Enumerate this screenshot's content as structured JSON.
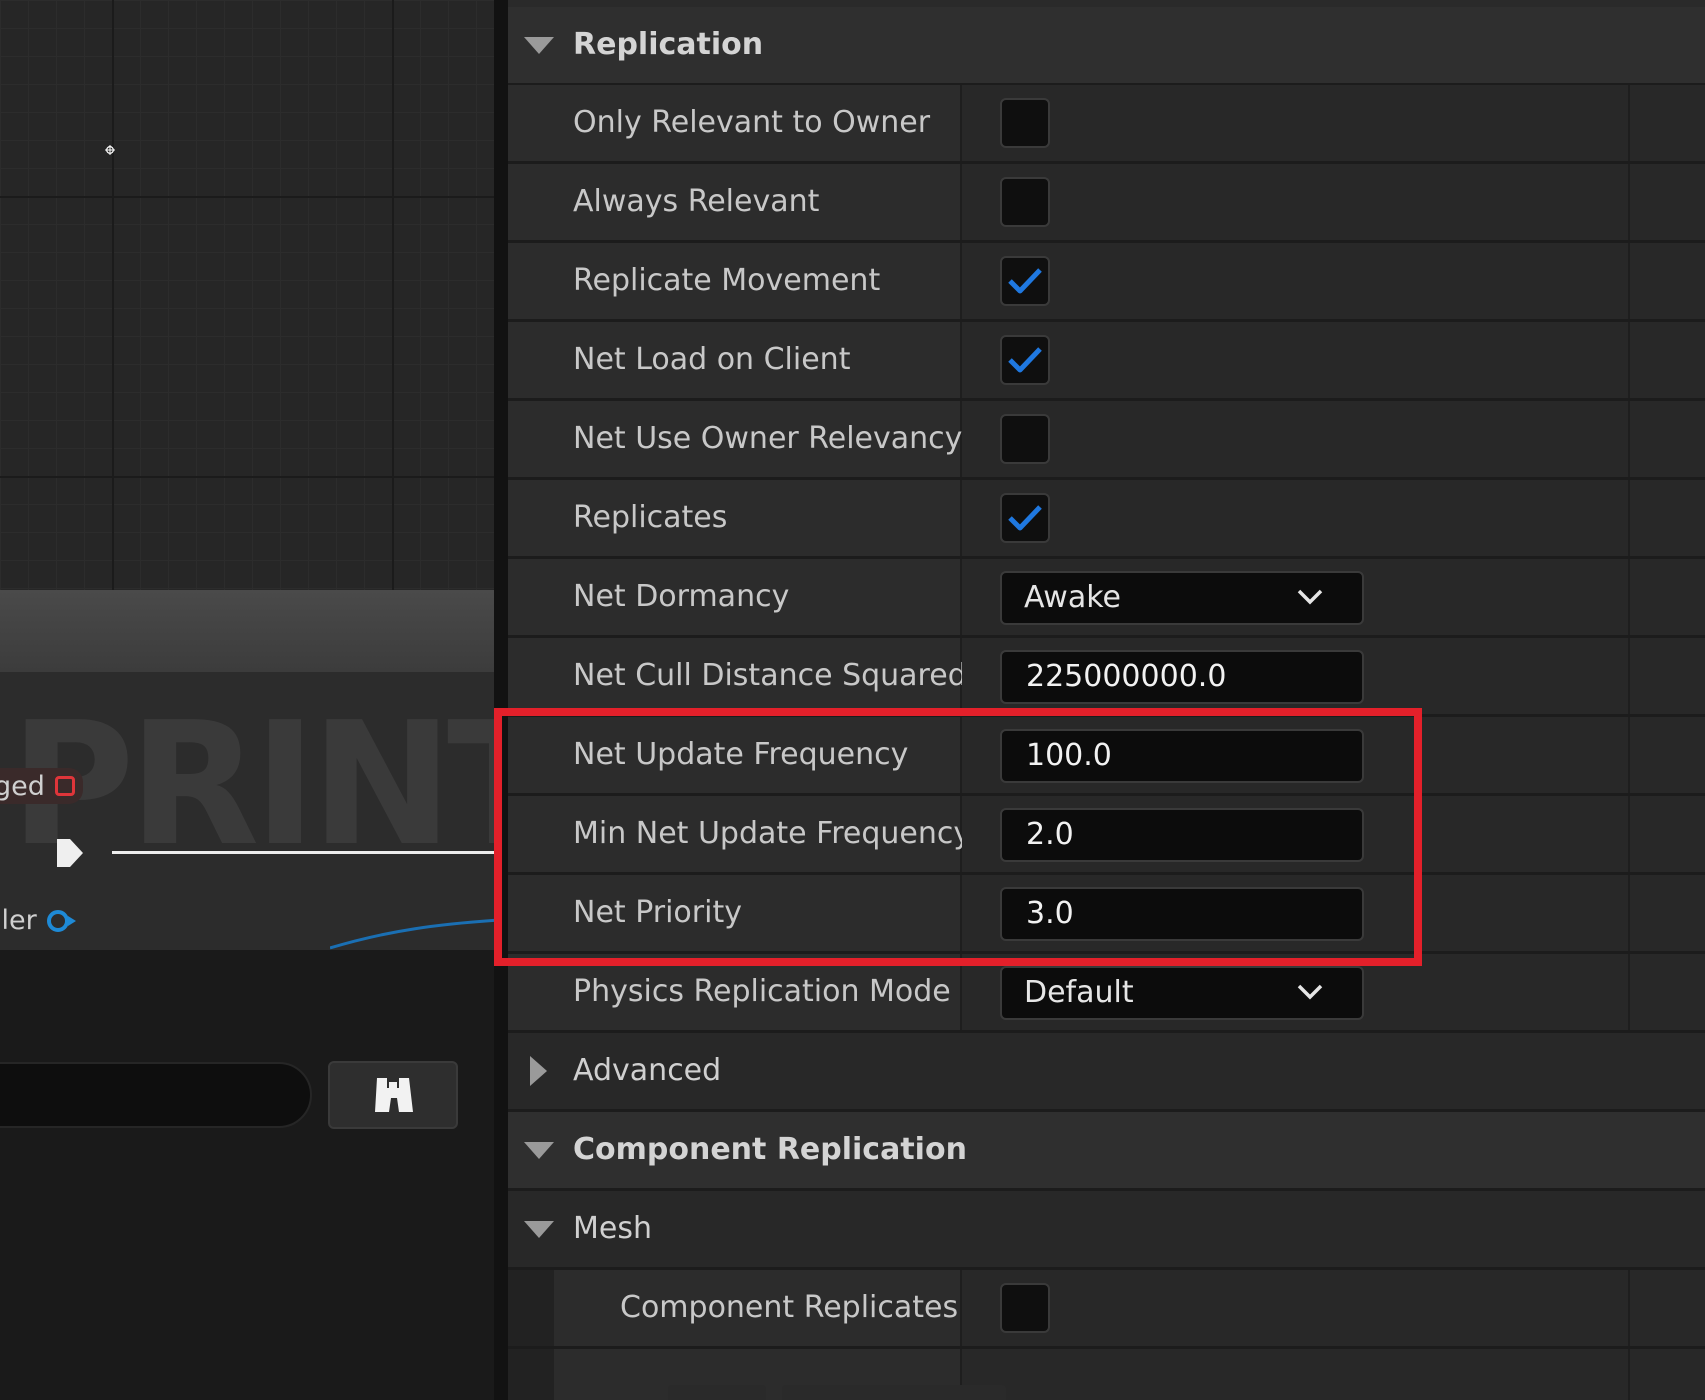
{
  "graph": {
    "watermark_text": "PRINT",
    "event_pin_label": "ged",
    "object_pin_label": "ller"
  },
  "details": {
    "replication": {
      "title": "Replication",
      "properties": [
        {
          "label": "Only Relevant to Owner",
          "checked": false
        },
        {
          "label": "Always Relevant",
          "checked": false
        },
        {
          "label": "Replicate Movement",
          "checked": true
        },
        {
          "label": "Net Load on Client",
          "checked": true
        },
        {
          "label": "Net Use Owner Relevancy",
          "checked": false
        },
        {
          "label": "Replicates",
          "checked": true
        }
      ],
      "net_dormancy": {
        "label": "Net Dormancy",
        "value": "Awake"
      },
      "net_cull_distance": {
        "label": "Net Cull Distance Squared",
        "value": "225000000.0"
      },
      "net_update_frequency": {
        "label": "Net Update Frequency",
        "value": "100.0"
      },
      "min_net_update_frequency": {
        "label": "Min Net Update Frequency",
        "value": "2.0"
      },
      "net_priority": {
        "label": "Net Priority",
        "value": "3.0"
      },
      "physics_replication_mode": {
        "label": "Physics Replication Mode",
        "value": "Default"
      },
      "advanced": "Advanced"
    },
    "component_replication": {
      "title": "Component Replication",
      "mesh": {
        "title": "Mesh",
        "component_replicates": {
          "label": "Component Replicates",
          "checked": false
        }
      }
    }
  },
  "colors": {
    "accent_check": "#1f78e0",
    "highlight": "#e3202a",
    "event_pin": "#e0353a",
    "object_pin": "#1e8ad6"
  }
}
